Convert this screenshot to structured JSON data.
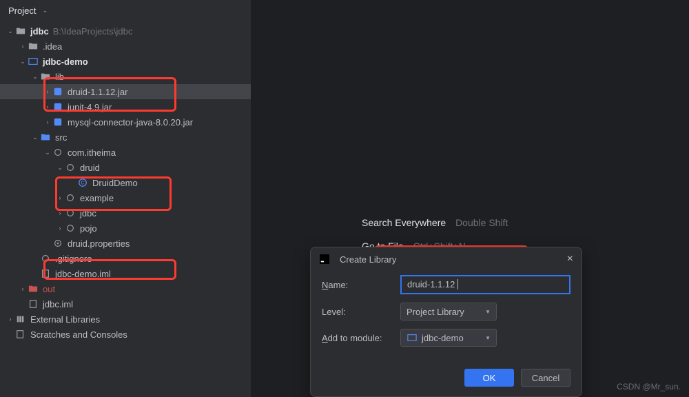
{
  "project": {
    "header": "Project",
    "root": {
      "name": "jdbc",
      "path": "B:\\IdeaProjects\\jdbc"
    },
    "tree": {
      "idea": ".idea",
      "demo": "jdbc-demo",
      "lib": "lib",
      "druid_jar": "druid-1.1.12.jar",
      "junit_jar": "junit-4.9.jar",
      "mysql_jar": "mysql-connector-java-8.0.20.jar",
      "src": "src",
      "pkg": "com.itheima",
      "druid_pkg": "druid",
      "druid_demo": "DruidDemo",
      "example": "example",
      "jdbc_pkg": "jdbc",
      "pojo": "pojo",
      "druid_props": "druid.properties",
      "gitignore": ".gitignore",
      "demo_iml": "jdbc-demo.iml",
      "out": "out",
      "jdbc_iml": "jdbc.iml",
      "ext_libs": "External Libraries",
      "scratches": "Scratches and Consoles"
    }
  },
  "hints": {
    "search": {
      "t": "Search Everywhere",
      "k": "Double Shift"
    },
    "gotofile": {
      "t": "Go to File",
      "k": "Ctrl+Shift+N"
    }
  },
  "dialog": {
    "title": "Create Library",
    "form": {
      "name_label": "Name:",
      "name_value": "druid-1.1.12",
      "level_label": "Level:",
      "level_value": "Project Library",
      "module_label": "Add to module:",
      "module_value": "jdbc-demo"
    },
    "ok": "OK",
    "cancel": "Cancel"
  },
  "watermark": "CSDN @Mr_sun."
}
